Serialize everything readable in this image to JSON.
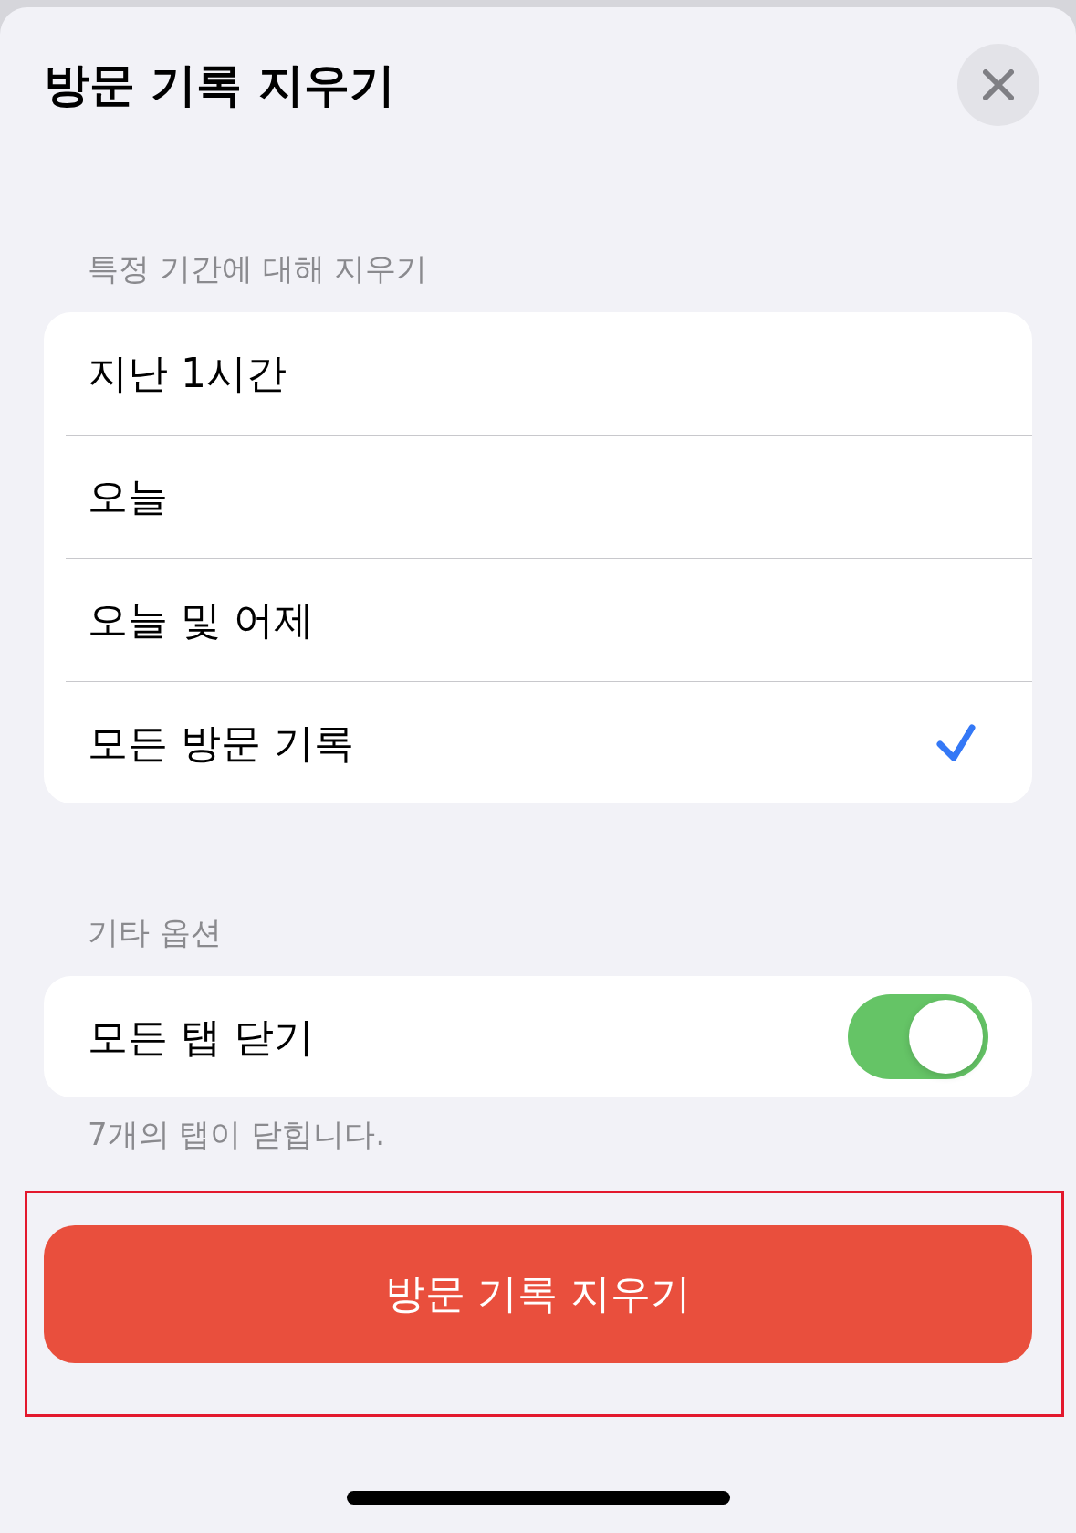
{
  "sheet": {
    "title": "방문 기록 지우기"
  },
  "sections": [
    {
      "header": "특정 기간에 대해 지우기",
      "rows": [
        {
          "kind": "choice",
          "label": "지난 1시간",
          "selected": false
        },
        {
          "kind": "choice",
          "label": "오늘",
          "selected": false
        },
        {
          "kind": "choice",
          "label": "오늘 및 어제",
          "selected": false
        },
        {
          "kind": "choice",
          "label": "모든 방문 기록",
          "selected": true
        }
      ]
    },
    {
      "header": "기타 옵션",
      "rows": [
        {
          "kind": "toggle",
          "label": "모든 탭 닫기",
          "on": true
        }
      ],
      "footer": "7개의 탭이 닫힙니다."
    }
  ],
  "primary_button": {
    "label": "방문 기록 지우기",
    "highlighted": true
  }
}
